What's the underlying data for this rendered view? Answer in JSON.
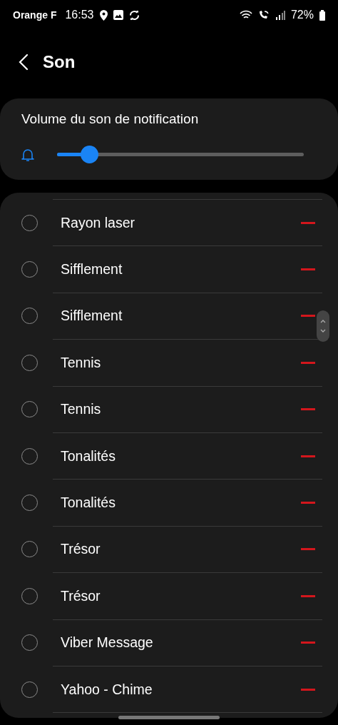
{
  "status_bar": {
    "carrier": "Orange F",
    "time": "16:53",
    "battery": "72%"
  },
  "header": {
    "title": "Son"
  },
  "volume": {
    "label": "Volume du son de notification",
    "level": 0.13
  },
  "sounds": [
    {
      "name": "Rayon laser",
      "selected": false
    },
    {
      "name": "Sifflement",
      "selected": false
    },
    {
      "name": "Sifflement",
      "selected": false
    },
    {
      "name": "Tennis",
      "selected": false
    },
    {
      "name": "Tennis",
      "selected": false
    },
    {
      "name": "Tonalités",
      "selected": false
    },
    {
      "name": "Tonalités",
      "selected": false
    },
    {
      "name": "Trésor",
      "selected": false
    },
    {
      "name": "Trésor",
      "selected": false
    },
    {
      "name": "Viber Message",
      "selected": false
    },
    {
      "name": "Yahoo - Chime",
      "selected": false
    }
  ]
}
